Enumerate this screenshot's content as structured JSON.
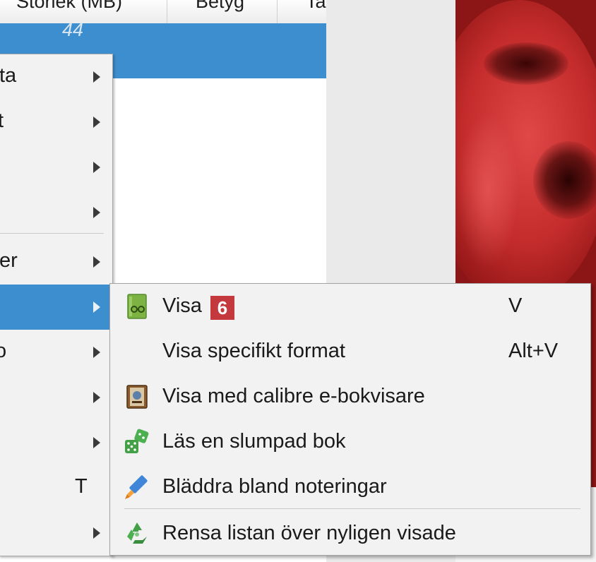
{
  "table_header": {
    "col_size": "Storlek (MB)",
    "col_rating": "Betyg",
    "col_tags": "Ta"
  },
  "selected_row": {
    "size_value": "44"
  },
  "main_menu": {
    "items": [
      {
        "label": "ta",
        "has_submenu": true
      },
      {
        "label": "t",
        "has_submenu": true
      },
      {
        "label": "",
        "has_submenu": true
      },
      {
        "label": "",
        "has_submenu": true
      },
      {
        "label": "er",
        "has_submenu": true
      },
      {
        "label": "",
        "has_submenu": true,
        "active": true
      },
      {
        "label": "o",
        "has_submenu": true
      },
      {
        "label": "",
        "has_submenu": true
      },
      {
        "label": "",
        "has_submenu": true
      },
      {
        "label": "",
        "shortcut": "T"
      },
      {
        "label": "",
        "has_submenu": true
      }
    ]
  },
  "submenu": {
    "items": [
      {
        "label": "Visa",
        "shortcut": "V",
        "icon": "book-reader-icon",
        "badge": "6"
      },
      {
        "label": "Visa specifikt format",
        "shortcut": "Alt+V"
      },
      {
        "label": "Visa med calibre e-bokvisare",
        "icon": "ebook-viewer-icon"
      },
      {
        "label": "Läs en slumpad bok",
        "icon": "dice-icon"
      },
      {
        "label": "Bläddra bland noteringar",
        "icon": "highlighter-icon"
      },
      {
        "label": "Rensa listan över nyligen visade",
        "icon": "recycle-icon"
      }
    ]
  },
  "colors": {
    "selection": "#3d8ecf",
    "menu_bg": "#f2f2f2",
    "badge": "#c4393d",
    "cover": "#8c1616"
  }
}
